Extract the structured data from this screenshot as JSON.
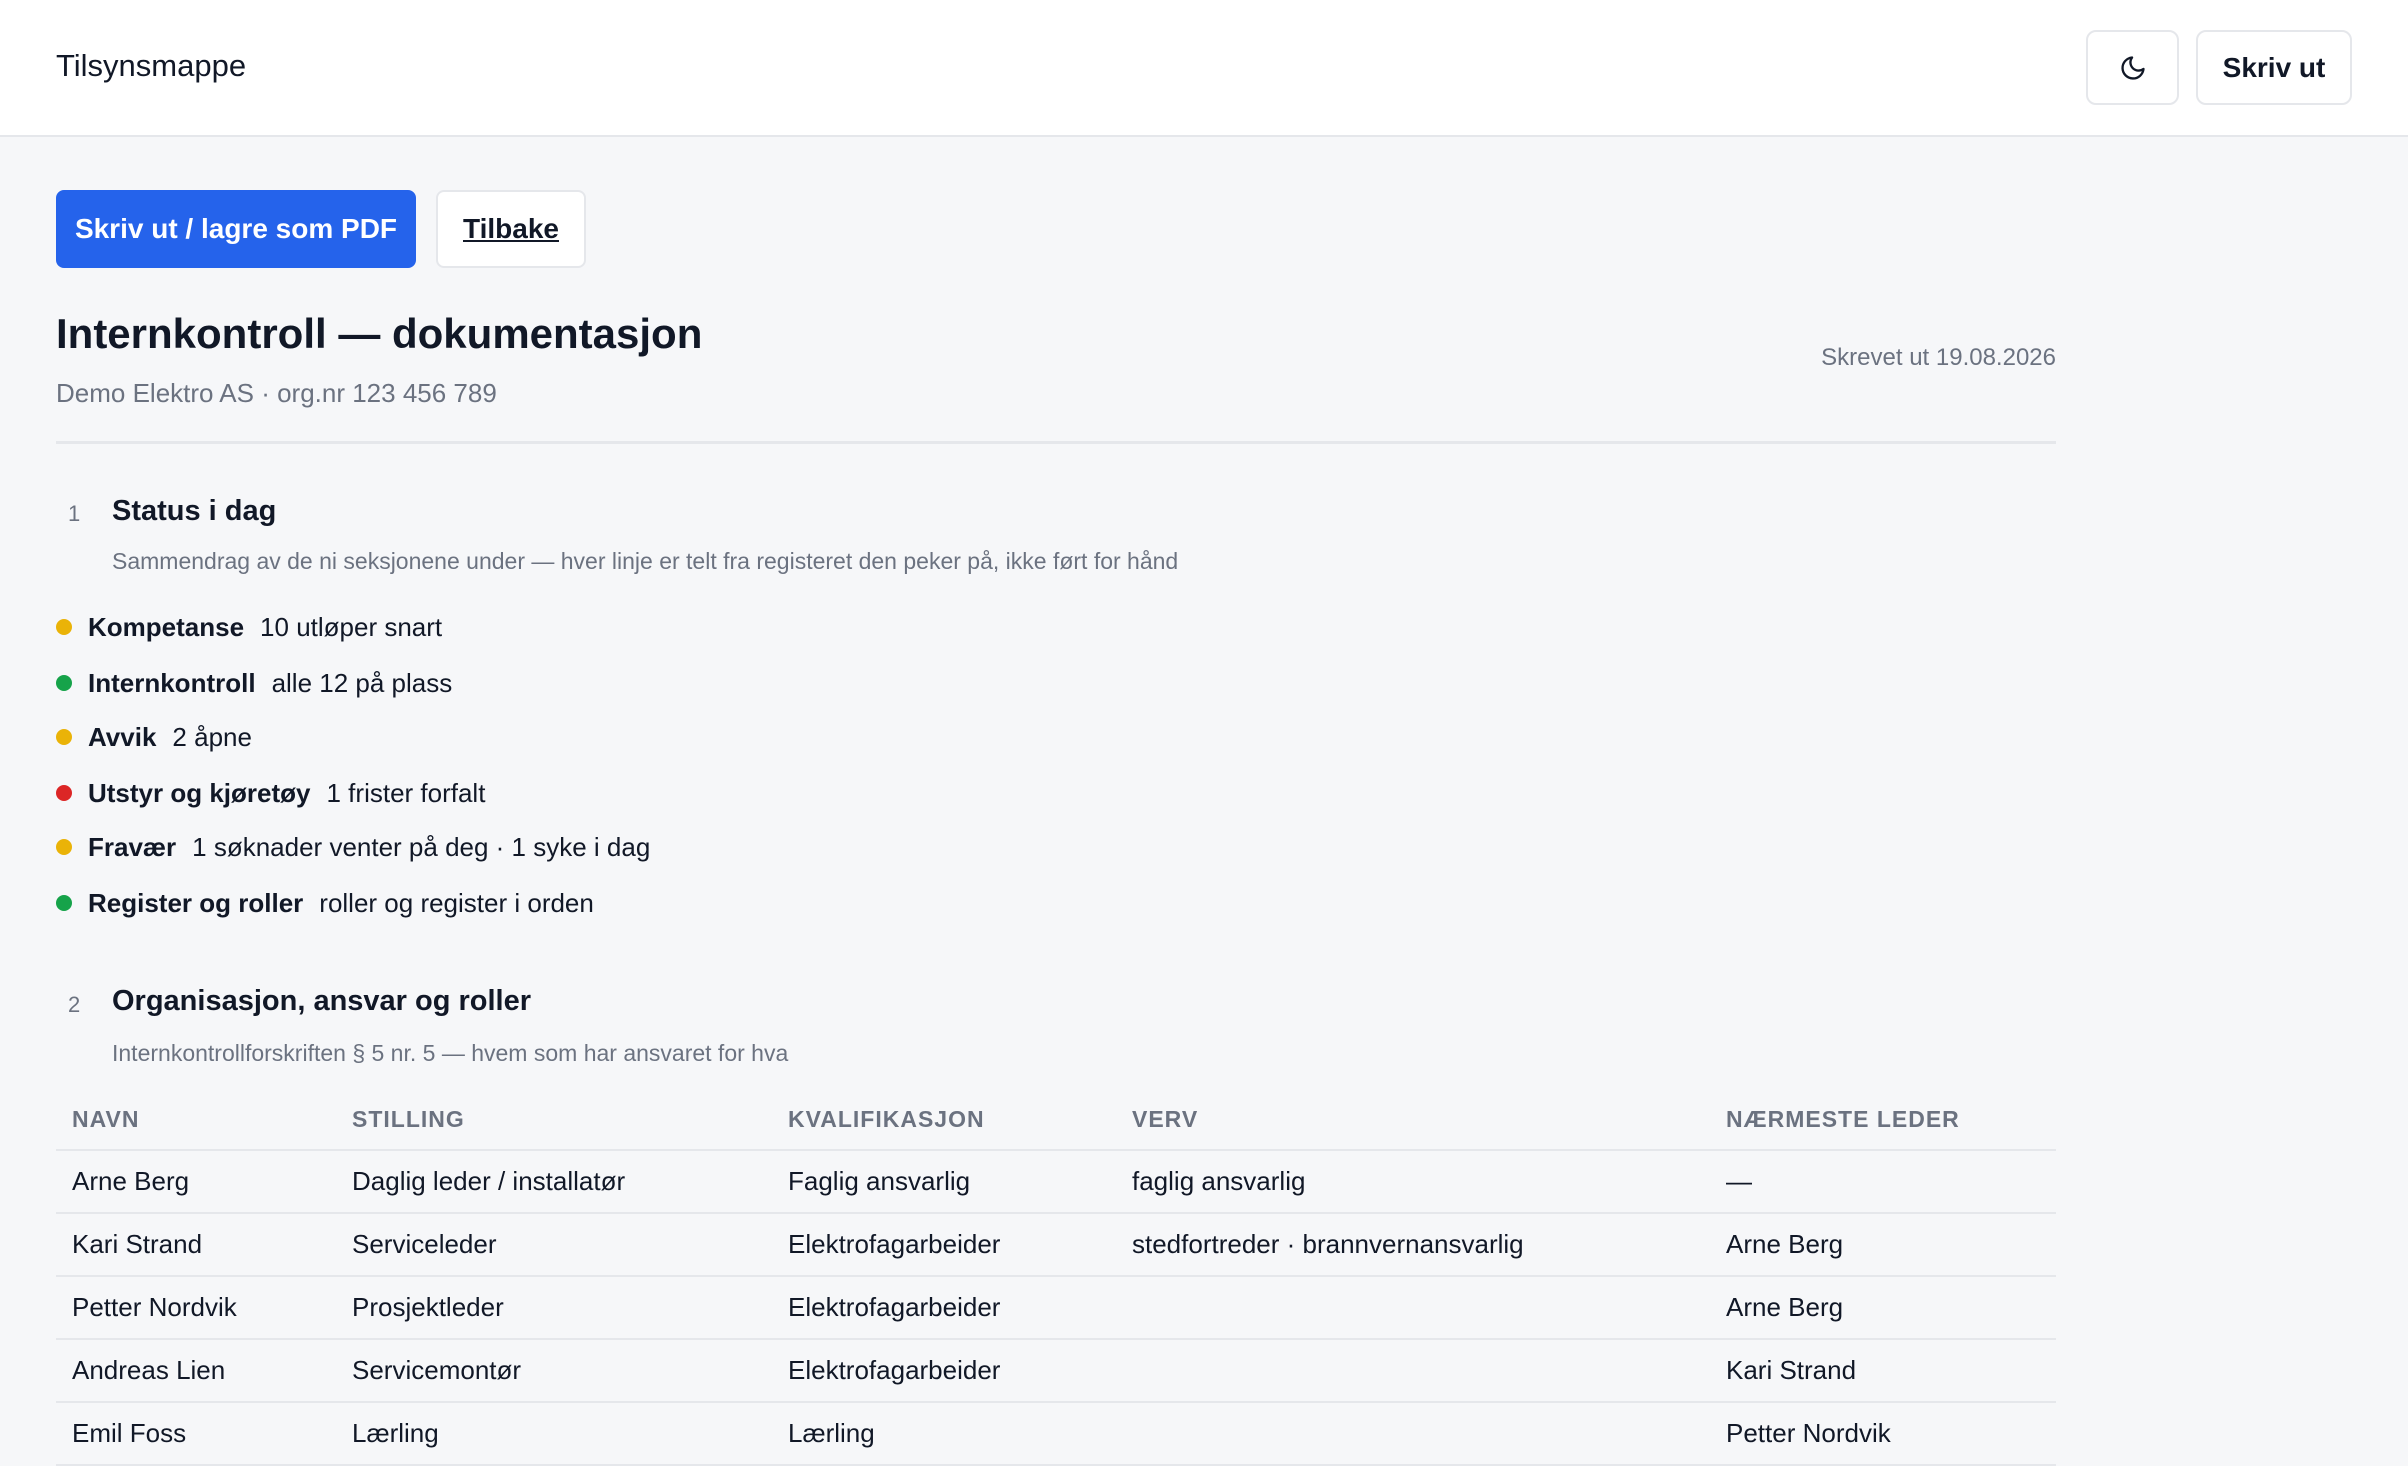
{
  "header": {
    "app_title": "Tilsynsmappe",
    "theme_icon": "moon-icon",
    "print_label": "Skriv ut"
  },
  "actions": {
    "primary_label": "Skriv ut / lagre som PDF",
    "back_label": "Tilbake"
  },
  "document": {
    "title": "Internkontroll — dokumentasjon",
    "subtitle": "Demo Elektro AS · org.nr 123 456 789",
    "printed_at": "Skrevet ut 19.08.2026"
  },
  "sections": [
    {
      "number": "1",
      "title": "Status i dag",
      "description": "Sammendrag av de ni seksjonene under — hver linje er telt fra registeret den peker på, ikke ført for hånd"
    },
    {
      "number": "2",
      "title": "Organisasjon, ansvar og roller",
      "description": "Internkontrollforskriften § 5 nr. 5 — hvem som har ansvaret for hva"
    }
  ],
  "status_items": [
    {
      "label": "Kompetanse",
      "value": "10 utløper snart",
      "color": "#eab308"
    },
    {
      "label": "Internkontroll",
      "value": "alle 12 på plass",
      "color": "#16a34a"
    },
    {
      "label": "Avvik",
      "value": "2 åpne",
      "color": "#eab308"
    },
    {
      "label": "Utstyr og kjøretøy",
      "value": "1 frister forfalt",
      "color": "#dc2626"
    },
    {
      "label": "Fravær",
      "value": "1 søknader venter på deg · 1 syke i dag",
      "color": "#eab308"
    },
    {
      "label": "Register og roller",
      "value": "roller og register i orden",
      "color": "#16a34a"
    }
  ],
  "roles_table": {
    "headers": [
      "NAVN",
      "STILLING",
      "KVALIFIKASJON",
      "VERV",
      "NÆRMESTE LEDER"
    ],
    "rows": [
      [
        "Arne Berg",
        "Daglig leder / installatør",
        "Faglig ansvarlig",
        "faglig ansvarlig",
        "—"
      ],
      [
        "Kari Strand",
        "Serviceleder",
        "Elektrofagarbeider",
        "stedfortreder · brannvernansvarlig",
        "Arne Berg"
      ],
      [
        "Petter Nordvik",
        "Prosjektleder",
        "Elektrofagarbeider",
        "",
        "Arne Berg"
      ],
      [
        "Andreas Lien",
        "Servicemontør",
        "Elektrofagarbeider",
        "",
        "Kari Strand"
      ],
      [
        "Emil Foss",
        "Lærling",
        "Lærling",
        "",
        "Petter Nordvik"
      ]
    ]
  }
}
